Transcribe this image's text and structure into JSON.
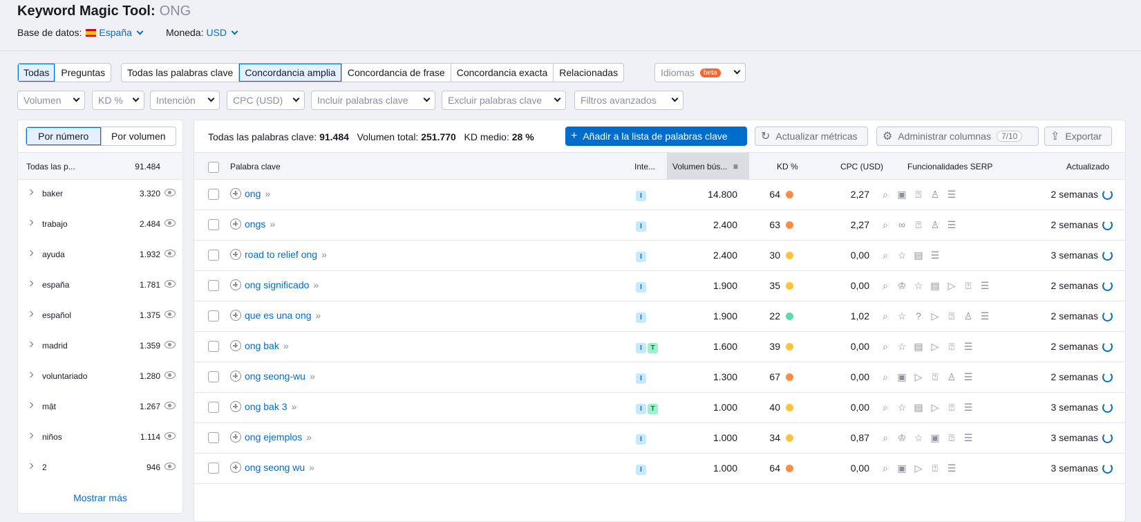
{
  "title": {
    "tool": "Keyword Magic Tool:",
    "query": "ONG"
  },
  "meta": {
    "database_label": "Base de datos:",
    "database_value": "España",
    "currency_label": "Moneda:",
    "currency_value": "USD"
  },
  "filters_row1": {
    "question_tabs": [
      {
        "label": "Todas",
        "active": true
      },
      {
        "label": "Preguntas",
        "active": false
      }
    ],
    "match_tabs": [
      {
        "label": "Todas las palabras clave",
        "active": false
      },
      {
        "label": "Concordancia amplia",
        "active": true
      },
      {
        "label": "Concordancia de frase",
        "active": false
      },
      {
        "label": "Concordancia exacta",
        "active": false
      },
      {
        "label": "Relacionadas",
        "active": false
      }
    ],
    "languages": {
      "label": "Idiomas",
      "badge": "beta"
    }
  },
  "filters_row2": [
    "Volumen",
    "KD %",
    "Intención",
    "CPC (USD)",
    "Incluir palabras clave",
    "Excluir palabras clave",
    "Filtros avanzados"
  ],
  "groups": {
    "toggle": [
      {
        "label": "Por número",
        "active": true
      },
      {
        "label": "Por volumen",
        "active": false
      }
    ],
    "header": {
      "name": "Todas las p...",
      "count": "91.484"
    },
    "items": [
      {
        "name": "baker",
        "count": "3.320"
      },
      {
        "name": "trabajo",
        "count": "2.484"
      },
      {
        "name": "ayuda",
        "count": "1.932"
      },
      {
        "name": "españa",
        "count": "1.781"
      },
      {
        "name": "español",
        "count": "1.375"
      },
      {
        "name": "madrid",
        "count": "1.359"
      },
      {
        "name": "voluntariado",
        "count": "1.280"
      },
      {
        "name": "mật",
        "count": "1.267"
      },
      {
        "name": "niños",
        "count": "1.114"
      },
      {
        "name": "2",
        "count": "946"
      }
    ],
    "show_more": "Mostrar más"
  },
  "summary": {
    "all_label": "Todas las palabras clave:",
    "all_value": "91.484",
    "volume_label": "Volumen total:",
    "volume_value": "251.770",
    "kd_label": "KD medio:",
    "kd_value": "28 %"
  },
  "toolbar": {
    "add": "Añadir a la lista de palabras clave",
    "update": "Actualizar métricas",
    "columns": "Administrar columnas",
    "columns_count": "7/10",
    "export": "Exportar"
  },
  "table": {
    "headers": {
      "keyword": "Palabra clave",
      "intent": "Inte...",
      "volume": "Volumen bús...",
      "kd": "KD %",
      "cpc": "CPC (USD)",
      "serp": "Funcionalidades SERP",
      "updated": "Actualizado"
    },
    "rows": [
      {
        "keyword": "ong",
        "intents": [
          "I"
        ],
        "volume": "14.800",
        "kd": "64",
        "kd_color": "#ff8c43",
        "cpc": "2,27",
        "serp": [
          "serp-icon",
          "image-icon",
          "faq-icon",
          "edu-icon",
          "list-icon"
        ],
        "updated": "2 semanas"
      },
      {
        "keyword": "ongs",
        "intents": [
          "I"
        ],
        "volume": "2.400",
        "kd": "63",
        "kd_color": "#ff8c43",
        "cpc": "2,27",
        "serp": [
          "serp-icon",
          "link-icon",
          "faq-icon",
          "edu-icon",
          "list-icon"
        ],
        "updated": "2 semanas"
      },
      {
        "keyword": "road to relief ong",
        "intents": [
          "I"
        ],
        "volume": "2.400",
        "kd": "30",
        "kd_color": "#fdc23c",
        "cpc": "0,00",
        "serp": [
          "serp-icon",
          "star-icon",
          "gallery-icon",
          "list-icon"
        ],
        "updated": "3 semanas"
      },
      {
        "keyword": "ong significado",
        "intents": [
          "I"
        ],
        "volume": "1.900",
        "kd": "35",
        "kd_color": "#fdc23c",
        "cpc": "0,00",
        "serp": [
          "serp-icon",
          "crown-icon",
          "star-icon",
          "gallery-icon",
          "video-icon",
          "faq-icon",
          "list-icon"
        ],
        "updated": "2 semanas"
      },
      {
        "keyword": "que es una ong",
        "intents": [
          "I"
        ],
        "volume": "1.900",
        "kd": "22",
        "kd_color": "#59ddaa",
        "cpc": "1,02",
        "serp": [
          "serp-icon",
          "star-icon",
          "question-icon",
          "video-icon",
          "faq-icon",
          "edu-icon",
          "list-icon"
        ],
        "updated": "2 semanas"
      },
      {
        "keyword": "ong bak",
        "intents": [
          "I",
          "T"
        ],
        "volume": "1.600",
        "kd": "39",
        "kd_color": "#fdc23c",
        "cpc": "0,00",
        "serp": [
          "serp-icon",
          "star-icon",
          "gallery-icon",
          "video-icon",
          "faq-icon",
          "list-icon"
        ],
        "updated": "2 semanas"
      },
      {
        "keyword": "ong seong-wu",
        "intents": [
          "I"
        ],
        "volume": "1.300",
        "kd": "67",
        "kd_color": "#ff8c43",
        "cpc": "0,00",
        "serp": [
          "serp-icon",
          "image-icon",
          "video-icon",
          "faq-icon",
          "edu-icon",
          "list-icon"
        ],
        "updated": "2 semanas"
      },
      {
        "keyword": "ong bak 3",
        "intents": [
          "I",
          "T"
        ],
        "volume": "1.000",
        "kd": "40",
        "kd_color": "#fdc23c",
        "cpc": "0,00",
        "serp": [
          "serp-icon",
          "star-icon",
          "gallery-icon",
          "video-icon",
          "faq-icon",
          "list-icon"
        ],
        "updated": "3 semanas"
      },
      {
        "keyword": "ong ejemplos",
        "intents": [
          "I"
        ],
        "volume": "1.000",
        "kd": "34",
        "kd_color": "#fdc23c",
        "cpc": "0,87",
        "serp": [
          "serp-icon",
          "crown-icon",
          "star-icon",
          "image-icon",
          "faq-icon",
          "list-icon"
        ],
        "updated": "3 semanas"
      },
      {
        "keyword": "ong seong wu",
        "intents": [
          "I"
        ],
        "volume": "1.000",
        "kd": "64",
        "kd_color": "#ff8c43",
        "cpc": "0,00",
        "serp": [
          "serp-icon",
          "image-icon",
          "video-icon",
          "faq-icon",
          "list-icon"
        ],
        "updated": "3 semanas"
      }
    ]
  }
}
